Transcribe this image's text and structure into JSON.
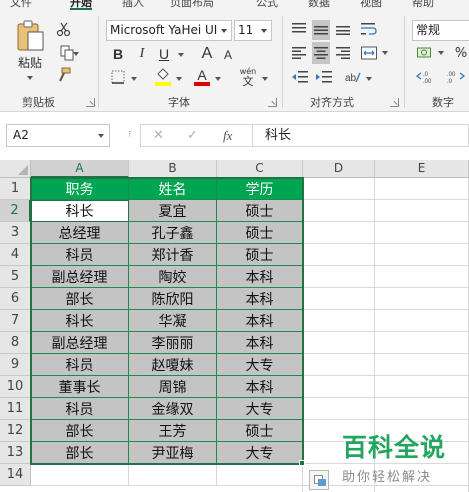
{
  "ribbon": {
    "tabs": [
      {
        "label": "文件",
        "active": false
      },
      {
        "label": "开始",
        "active": true
      },
      {
        "label": "插入",
        "active": false
      },
      {
        "label": "页面布局",
        "active": false
      },
      {
        "label": "公式",
        "active": false
      },
      {
        "label": "数据",
        "active": false
      },
      {
        "label": "视图",
        "active": false
      },
      {
        "label": "帮助",
        "active": false
      }
    ],
    "clipboard": {
      "group_label": "剪贴板",
      "paste_label": "粘贴"
    },
    "font": {
      "group_label": "字体",
      "font_name": "Microsoft YaHei UI",
      "font_size": "11",
      "bold": "B",
      "italic": "I",
      "underline": "U",
      "grow": "A",
      "shrink": "A",
      "font_color_letter": "A",
      "phonetic_top": "wén",
      "phonetic_bottom": "文"
    },
    "alignment": {
      "group_label": "对齐方式"
    },
    "number": {
      "group_label": "数字",
      "format": "常规"
    },
    "colors": {
      "accent": "#217346",
      "fill_yellow": "#ffff00",
      "font_red": "#e00000"
    }
  },
  "formula_bar": {
    "name_box": "A2",
    "fx": "fx",
    "content": "科长"
  },
  "grid": {
    "columns": [
      "A",
      "B",
      "C",
      "D",
      "E"
    ],
    "rows": [
      "1",
      "2",
      "3",
      "4",
      "5",
      "6",
      "7",
      "8",
      "9",
      "10",
      "11",
      "12",
      "13",
      "14"
    ],
    "header": [
      "职务",
      "姓名",
      "学历"
    ],
    "data": [
      [
        "科长",
        "夏宜",
        "硕士"
      ],
      [
        "总经理",
        "孔子鑫",
        "硕士"
      ],
      [
        "科员",
        "郑计香",
        "硕士"
      ],
      [
        "副总经理",
        "陶姣",
        "本科"
      ],
      [
        "部长",
        "陈欣阳",
        "本科"
      ],
      [
        "科长",
        "华凝",
        "本科"
      ],
      [
        "副总经理",
        "李丽丽",
        "本科"
      ],
      [
        "科员",
        "赵嗄妹",
        "大专"
      ],
      [
        "董事长",
        "周锦",
        "本科"
      ],
      [
        "科员",
        "金缘双",
        "大专"
      ],
      [
        "部长",
        "王芳",
        "硕士"
      ],
      [
        "部长",
        "尹亚梅",
        "大专"
      ]
    ],
    "header_color": "#00a552",
    "selection_fill": "#c4c4c4"
  },
  "watermark": {
    "title": "百科全说",
    "subtitle": "助你轻松解决"
  }
}
